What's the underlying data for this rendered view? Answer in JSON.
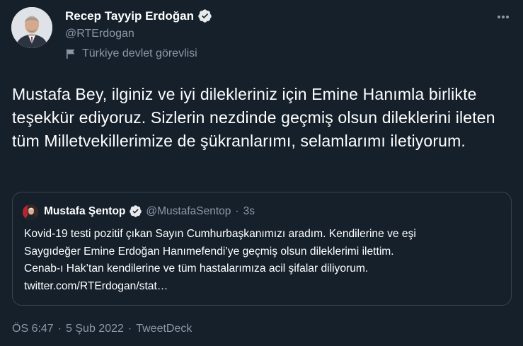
{
  "author": {
    "name": "Recep Tayyip Erdoğan",
    "handle": "@RTErdogan",
    "label": "Türkiye devlet görevlisi",
    "verified_color": "#1d9bf0"
  },
  "more_icon": "more-horizontal-icon",
  "tweet_text": "Mustafa Bey, ilginiz ve iyi dilekleriniz için Emine Hanımla birlikte teşekkür ediyoruz. Sizlerin nezdinde geçmiş olsun dileklerini ileten tüm Milletvekillerimize de şükranlarımı, selamlarımı iletiyorum.",
  "quote": {
    "name": "Mustafa Şentop",
    "handle": "@MustafaSentop",
    "dot": "·",
    "time": "3s",
    "lines": [
      "Kovid-19 testi pozitif çıkan Sayın Cumhurbaşkanımızı aradım. Kendilerine ve eşi",
      "Saygıdeğer Emine Erdoğan Hanımefendi’ye geçmiş olsun dileklerimi ilettim.",
      "Cenab-ı Hak’tan kendilerine ve tüm hastalarımıza acil şifalar diliyorum.",
      "twitter.com/RTErdogan/stat…"
    ]
  },
  "meta": {
    "time": "ÖS 6:47",
    "sep": "·",
    "date": "5 Şub 2022",
    "source": "TweetDeck"
  },
  "colors": {
    "background": "#15202b",
    "secondary_text": "#8b98a5",
    "border": "#38444d",
    "accent": "#1d9bf0"
  }
}
